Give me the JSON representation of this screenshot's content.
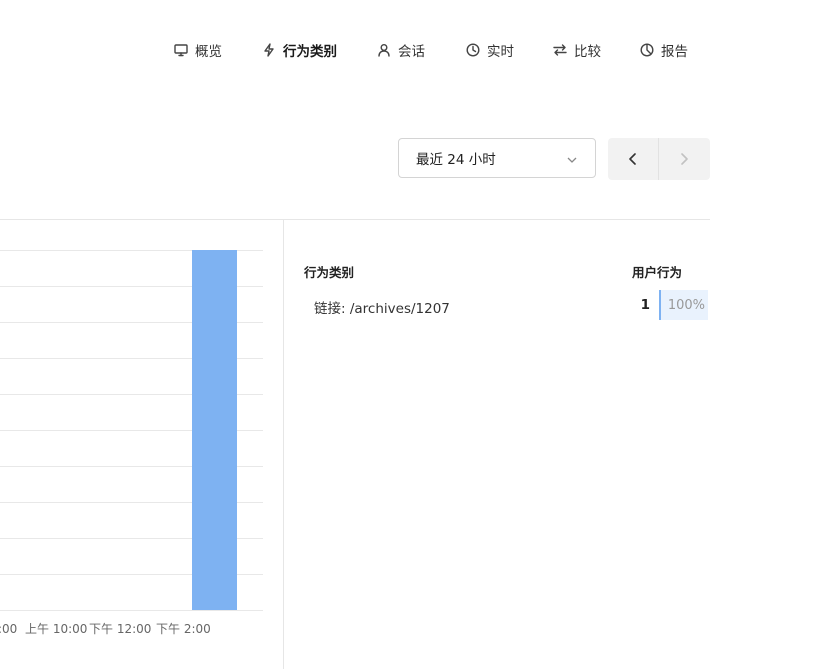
{
  "nav": {
    "items": [
      {
        "label": "概览",
        "icon": "monitor-icon",
        "active": false
      },
      {
        "label": "行为类别",
        "icon": "bolt-icon",
        "active": true
      },
      {
        "label": "会话",
        "icon": "user-icon",
        "active": false
      },
      {
        "label": "实时",
        "icon": "clock-icon",
        "active": false
      },
      {
        "label": "比较",
        "icon": "compare-arrows-icon",
        "active": false
      },
      {
        "label": "报告",
        "icon": "pie-chart-icon",
        "active": false
      }
    ]
  },
  "controls": {
    "range_value": "最近 24 小时",
    "prev_icon": "chevron-left-icon",
    "next_icon": "chevron-right-icon",
    "next_disabled": true
  },
  "chart_data": {
    "type": "bar",
    "x_tick_labels": [
      ":00",
      "上午 10:00",
      "下午 12:00",
      "下午 2:00"
    ],
    "series": [
      {
        "values": [
          0,
          0,
          0,
          0,
          0,
          0,
          1
        ]
      }
    ],
    "bar_color": "#7eb2f2",
    "grid": true,
    "ylim": [
      0,
      1
    ]
  },
  "table": {
    "col_category": "行为类别",
    "col_events": "用户行为",
    "rows": [
      {
        "label": "链接: /archives/1207",
        "count": "1",
        "percent": "100%",
        "share": 1.0
      }
    ]
  },
  "colors": {
    "accent": "#7eb2f2",
    "accent_light": "#e9f2fd"
  }
}
